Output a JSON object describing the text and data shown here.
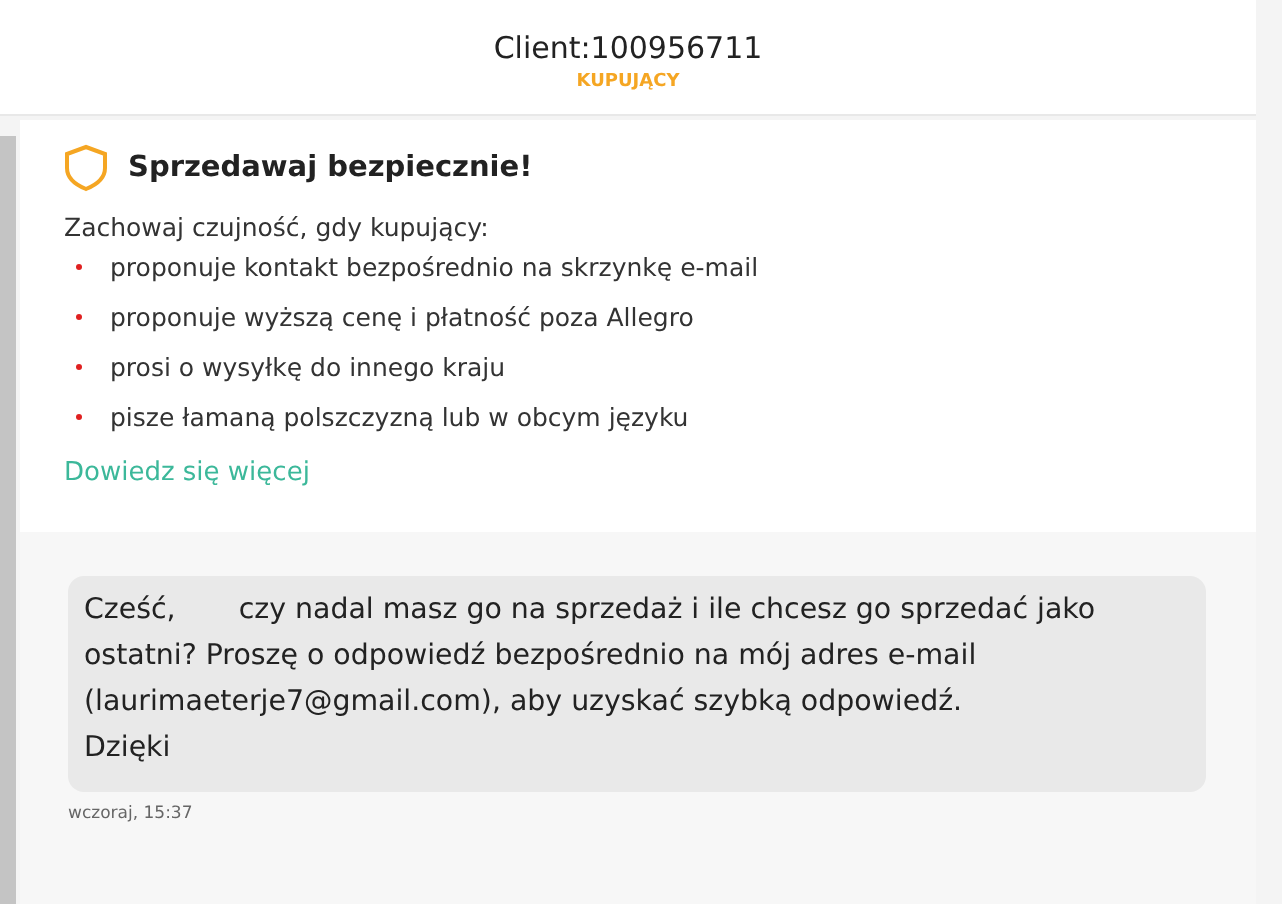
{
  "header": {
    "title": "Client:100956711",
    "role": "KUPUJĄCY"
  },
  "safety": {
    "title": "Sprzedawaj bezpiecznie!",
    "intro": "Zachowaj czujność, gdy kupujący:",
    "items": [
      "proponuje kontakt bezpośrednio na skrzynkę e-mail",
      "proponuje wyższą cenę i płatność poza Allegro",
      "prosi o wysyłkę do innego kraju",
      "pisze łamaną polszczyzną lub w obcym języku"
    ],
    "link": "Dowiedz się więcej"
  },
  "messages": [
    {
      "text": "Cześć,       czy nadal masz go na sprzedaż i ile chcesz go sprzedać jako\nostatni? Proszę o odpowiedź bezpośrednio na mój adres e-mail\n(laurimaeterje7@gmail.com), aby uzyskać szybką odpowiedź.\nDzięki",
      "time": "wczoraj, 15:37"
    }
  ]
}
